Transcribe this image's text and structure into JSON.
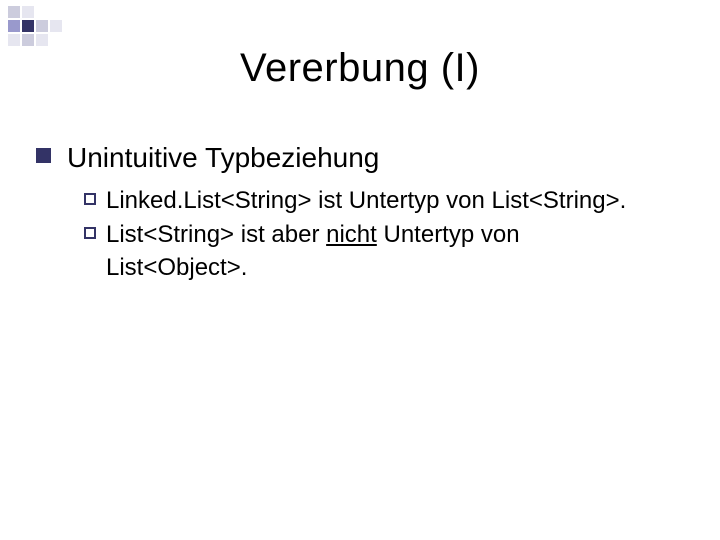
{
  "title": "Vererbung (I)",
  "heading": "Unintuitive Typbeziehung",
  "items": [
    {
      "pre": "Linked.List<String> ist Untertyp von List<String>."
    },
    {
      "a": "List<String> ist aber ",
      "u": "nicht",
      "b": " Untertyp von List<Object>."
    }
  ],
  "deco": {
    "dark": "#333366",
    "mid": "#9999cc",
    "light": "#ccccdd",
    "pale": "#e6e6f0"
  }
}
